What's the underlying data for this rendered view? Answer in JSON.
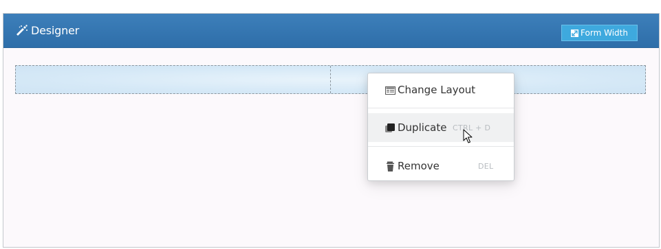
{
  "header": {
    "title": "Designer",
    "title_icon": "magic-wand-icon",
    "form_width_label": "Form Width",
    "form_width_icon": "expand-icon"
  },
  "colors": {
    "header_bg": "#2e6ea9",
    "button_bg": "#3ea9de",
    "row_bg": "#d6e9f7",
    "panel_bg": "#fcf9fc"
  },
  "layout_row": {
    "columns": 2
  },
  "context_menu": {
    "items": [
      {
        "label": "Change Layout",
        "icon": "layout-icon",
        "shortcut": ""
      },
      {
        "label": "Duplicate",
        "icon": "duplicate-icon",
        "shortcut": "CTRL + D"
      },
      {
        "label": "Remove",
        "icon": "trash-icon",
        "shortcut": "DEL"
      }
    ],
    "hovered_item": "Duplicate"
  }
}
